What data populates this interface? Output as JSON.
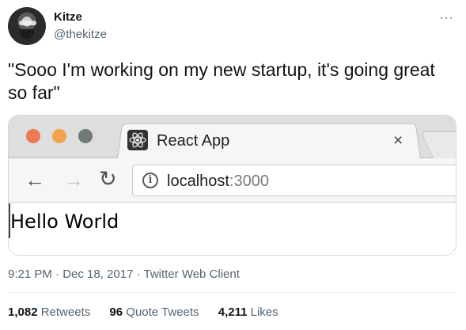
{
  "author": {
    "name": "Kitze",
    "handle": "@thekitze",
    "more_icon": "more-horizontal-icon"
  },
  "tweet": {
    "text": "\"Sooo I'm working on my new startup, it's going great so far\""
  },
  "browser": {
    "tab_title": "React App",
    "tab_icon": "react-logo-icon",
    "close_label": "×",
    "url_host": "localhost",
    "url_port": ":3000",
    "page_text": "Hello World",
    "colors": {
      "close": "#ec7b55",
      "minimize": "#f2a24a",
      "maximize": "#6f7a74"
    }
  },
  "meta": {
    "timestamp": "9:21 PM · Dec 18, 2017 · Twitter Web Client"
  },
  "stats": {
    "retweets_count": "1,082",
    "retweets_label": "Retweets",
    "quotes_count": "96",
    "quotes_label": "Quote Tweets",
    "likes_count": "4,211",
    "likes_label": "Likes"
  }
}
